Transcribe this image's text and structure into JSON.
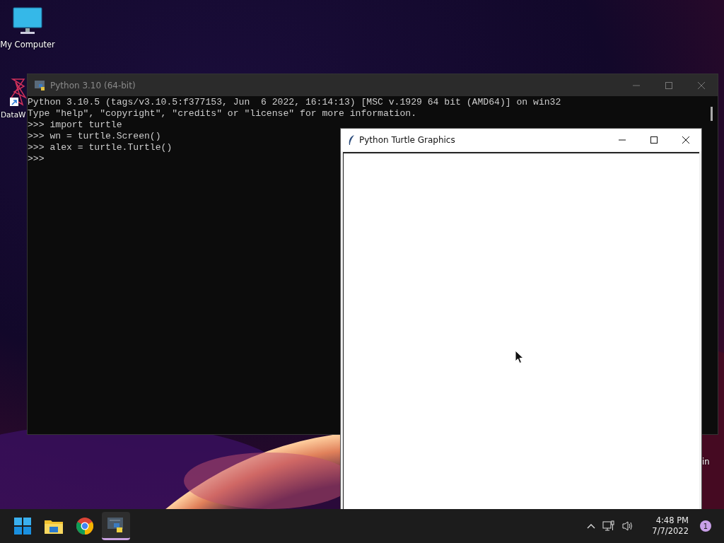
{
  "desktop": {
    "icons": [
      {
        "kind": "computer",
        "label": "My Computer"
      },
      {
        "kind": "shortcut",
        "label": "DataW"
      },
      {
        "kind": "bin",
        "label": "in"
      }
    ]
  },
  "console": {
    "title": "Python 3.10 (64-bit)",
    "lines": [
      "Python 3.10.5 (tags/v3.10.5:f377153, Jun  6 2022, 16:14:13) [MSC v.1929 64 bit (AMD64)] on win32",
      "Type \"help\", \"copyright\", \"credits\" or \"license\" for more information.",
      ">>> import turtle",
      ">>> wn = turtle.Screen()",
      ">>> alex = turtle.Turtle()",
      ">>>"
    ]
  },
  "turtle_window": {
    "title": "Python Turtle Graphics"
  },
  "taskbar": {
    "apps": [
      {
        "kind": "start",
        "selected": false
      },
      {
        "kind": "explorer",
        "selected": false
      },
      {
        "kind": "chrome",
        "selected": false
      },
      {
        "kind": "python",
        "selected": true
      }
    ],
    "tray": {
      "time": "4:48 PM",
      "date": "7/7/2022",
      "badge": "1"
    }
  }
}
